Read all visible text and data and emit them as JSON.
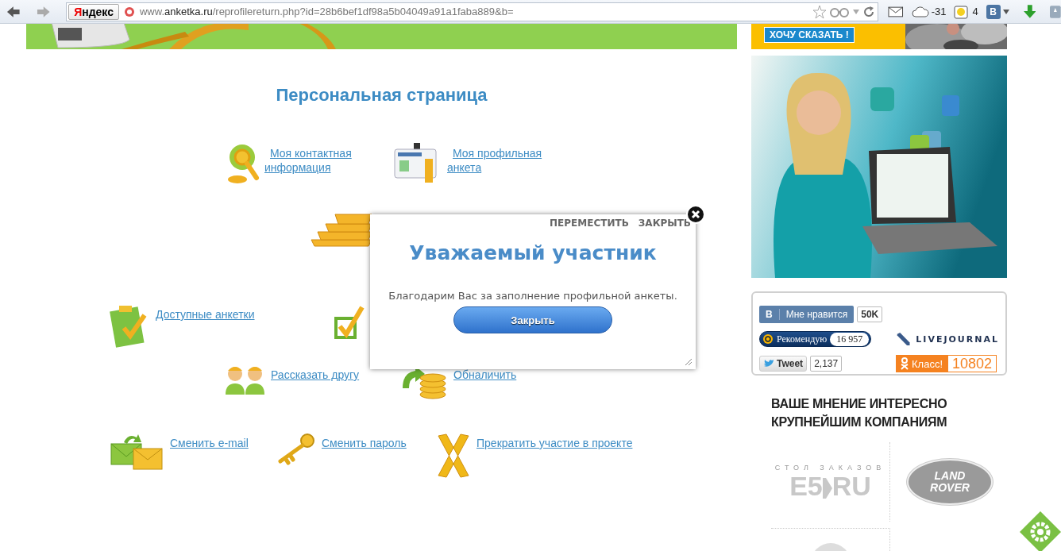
{
  "browser": {
    "search_button": "Яндекс",
    "url": "www.**anketka.ru**/reprofilereturn.php?id=28b6bef1df98a5b04049a91a1faba889&b=",
    "weather": "-31",
    "notifications": "4",
    "vk_button": "В"
  },
  "page": {
    "title": "Персональная страница",
    "menu_rows": [
      [
        {
          "kind": "contact",
          "label": "Моя контактная информация"
        },
        {
          "kind": "profile",
          "label": "Моя профильная анкета"
        }
      ],
      [
        {
          "kind": "gold"
        }
      ],
      [
        {
          "kind": "surveys",
          "label": "Доступные анкетки"
        },
        {
          "kind": "check"
        }
      ],
      [
        {
          "kind": "friends",
          "label": "Рассказать другу"
        },
        {
          "kind": "cash",
          "label": "Обналичить"
        }
      ],
      [
        {
          "kind": "email",
          "label": "Сменить e-mail"
        },
        {
          "kind": "password",
          "label": "Сменить пароль"
        },
        {
          "kind": "quit",
          "label": "Прекратить участие в проекте"
        }
      ]
    ]
  },
  "dialog": {
    "actions": [
      "ПЕРЕМЕСТИТЬ",
      "ЗАКРЫТЬ"
    ],
    "title": "Уважаемый участник",
    "message": "Благодарим Вас за заполнение профильной анкеты.",
    "button": "Закрыть"
  },
  "sidebar": {
    "banner_button": "ХОЧУ СКАЗАТЬ !",
    "social": [
      {
        "kind": "vk",
        "badge": "В",
        "label": "Мне нравится",
        "count": "50K"
      },
      {
        "kind": "mail",
        "label": "Рекомендую",
        "count": "16 957"
      },
      {
        "kind": "lj",
        "label": "LIVEJOURNAL"
      },
      {
        "kind": "twitter",
        "label": "Tweet",
        "count": "2,137"
      },
      {
        "kind": "ok",
        "label": "Класс!",
        "count": "10802"
      }
    ],
    "heading": "ВАШЕ МНЕНИЕ ИНТЕРЕСНО КРУПНЕЙШИМ КОМПАНИЯМ",
    "partners": [
      {
        "kind": "e5",
        "caption": "СТОЛ ЗАКАЗОВ",
        "name": "E5",
        "suffix": "RU"
      },
      {
        "kind": "landrover",
        "lines": [
          "LAND",
          "ROVER"
        ]
      },
      {
        "kind": "round"
      }
    ]
  }
}
